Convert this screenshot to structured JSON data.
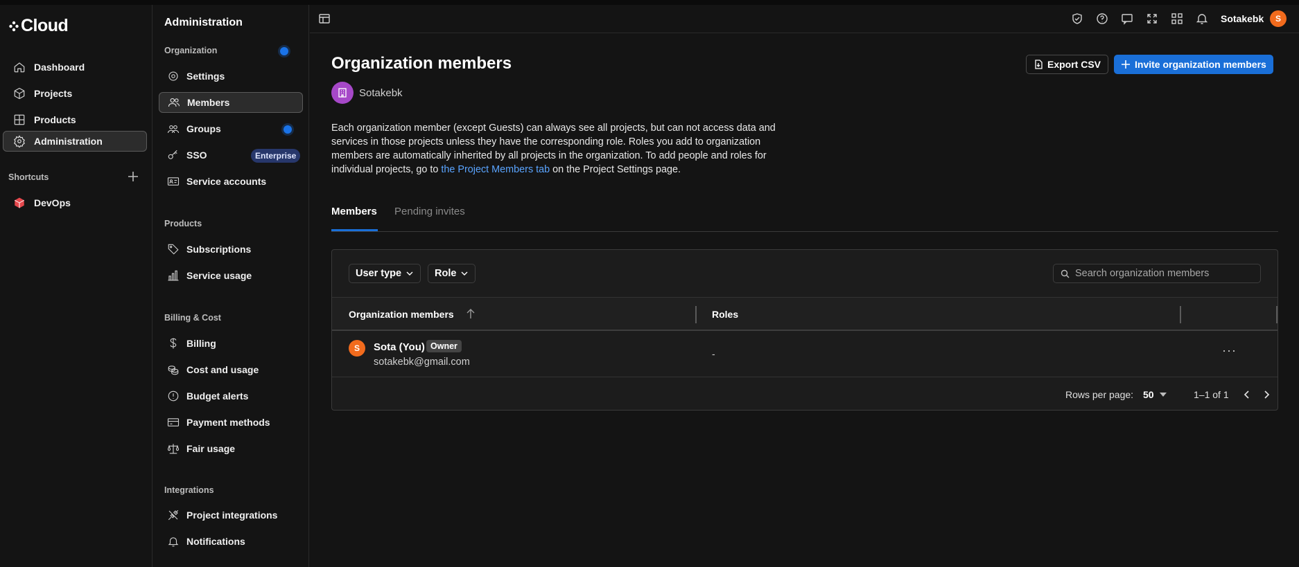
{
  "nav": {
    "logo": "Cloud",
    "items": [
      {
        "label": "Dashboard",
        "icon": "home-icon"
      },
      {
        "label": "Projects",
        "icon": "cube-icon"
      },
      {
        "label": "Products",
        "icon": "grid-icon"
      },
      {
        "label": "Administration",
        "icon": "gear-icon"
      }
    ],
    "shortcuts_label": "Shortcuts",
    "shortcut_item": "DevOps"
  },
  "admin": {
    "title": "Administration",
    "sections": {
      "organization": "Organization",
      "products": "Products",
      "billing": "Billing & Cost",
      "integrations": "Integrations"
    },
    "items": {
      "settings": "Settings",
      "members": "Members",
      "groups": "Groups",
      "sso": "SSO",
      "sso_badge": "Enterprise",
      "service_accounts": "Service accounts",
      "subscriptions": "Subscriptions",
      "service_usage": "Service usage",
      "billing": "Billing",
      "cost_usage": "Cost and usage",
      "budget_alerts": "Budget alerts",
      "payment_methods": "Payment methods",
      "fair_usage": "Fair usage",
      "project_integrations": "Project integrations",
      "notifications": "Notifications"
    }
  },
  "header": {
    "username": "Sotakebk",
    "avatar_letter": "S"
  },
  "page": {
    "title": "Organization members",
    "export_label": "Export CSV",
    "invite_label": "Invite organization members",
    "org_name": "Sotakebk",
    "description_1": "Each organization member (except Guests) can always see all projects, but can not access data and services in those projects unless they have the corresponding role. Roles you add to organization members are automatically inherited by all projects in the organization. To add people and roles for individual projects, go to ",
    "description_link": "the Project Members tab",
    "description_2": " on the Project Settings page."
  },
  "tabs": [
    {
      "label": "Members",
      "active": true
    },
    {
      "label": "Pending invites",
      "active": false
    }
  ],
  "table": {
    "filter_user_type": "User type",
    "filter_role": "Role",
    "search_placeholder": "Search organization members",
    "columns": [
      "Organization members",
      "Roles"
    ],
    "rows": [
      {
        "avatar": "S",
        "name": "Sota (You)",
        "badge": "Owner",
        "email": "sotakebk@gmail.com",
        "roles": "-"
      }
    ],
    "rows_per_page_label": "Rows per page:",
    "rows_per_page": "50",
    "range": "1–1 of 1"
  },
  "colors": {
    "accent": "#1a6fd8",
    "avatar": "#f26b1d",
    "org_badge": "#a648c8",
    "background": "#141414"
  }
}
